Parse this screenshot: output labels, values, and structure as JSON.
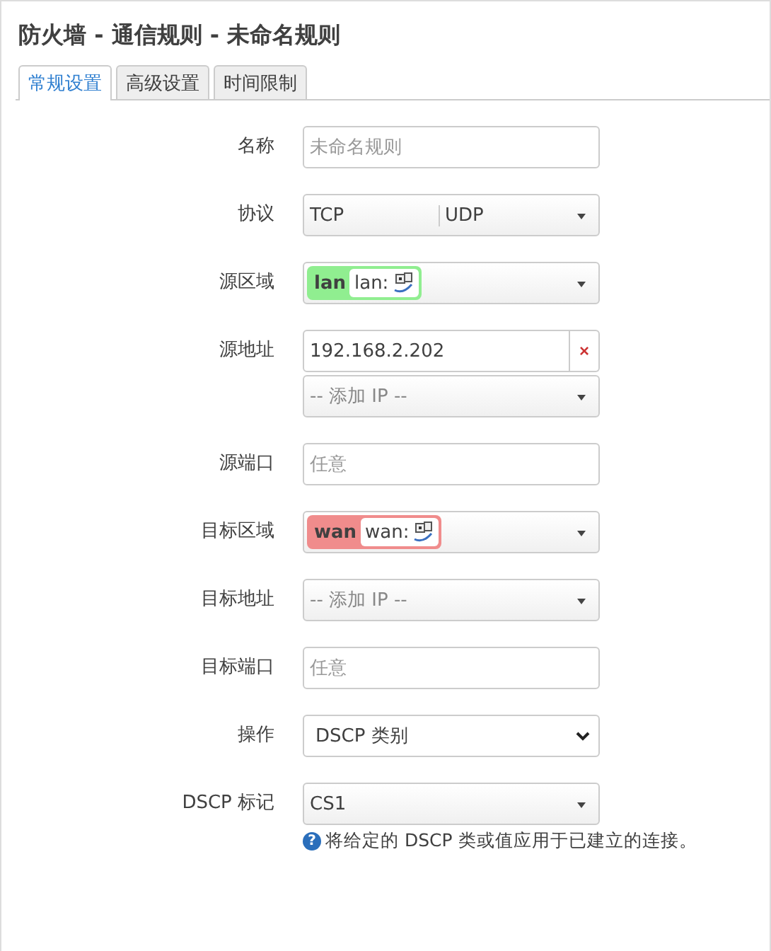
{
  "title": "防火墙 - 通信规则 - 未命名规则",
  "tabs": [
    {
      "label": "常规设置",
      "selected": true
    },
    {
      "label": "高级设置",
      "selected": false
    },
    {
      "label": "时间限制",
      "selected": false
    }
  ],
  "fields": [
    {
      "kind": "text",
      "label": "名称",
      "placeholder": "未命名规则"
    },
    {
      "kind": "multi",
      "label": "协议",
      "values": [
        "TCP",
        "UDP"
      ]
    },
    {
      "kind": "zone",
      "label": "源区域",
      "zone": "lan",
      "detail": "lan:",
      "color": "#90ee90"
    },
    {
      "kind": "address",
      "label": "源地址",
      "value": "192.168.2.202",
      "clear": "×",
      "add": "-- 添加 IP --"
    },
    {
      "kind": "text",
      "label": "源端口",
      "placeholder": "任意"
    },
    {
      "kind": "zone",
      "label": "目标区域",
      "zone": "wan",
      "detail": "wan:",
      "color": "#f08c8c"
    },
    {
      "kind": "dropdown",
      "label": "目标地址",
      "placeholder": "-- 添加 IP --"
    },
    {
      "kind": "text",
      "label": "目标端口",
      "placeholder": "任意"
    },
    {
      "kind": "select",
      "label": "操作",
      "value": "DSCP 类别"
    },
    {
      "kind": "dropdown",
      "label": "DSCP 标记",
      "value": "CS1",
      "help_icon": "?",
      "help": "将给定的 DSCP 类或值应用于已建立的连接。"
    }
  ]
}
